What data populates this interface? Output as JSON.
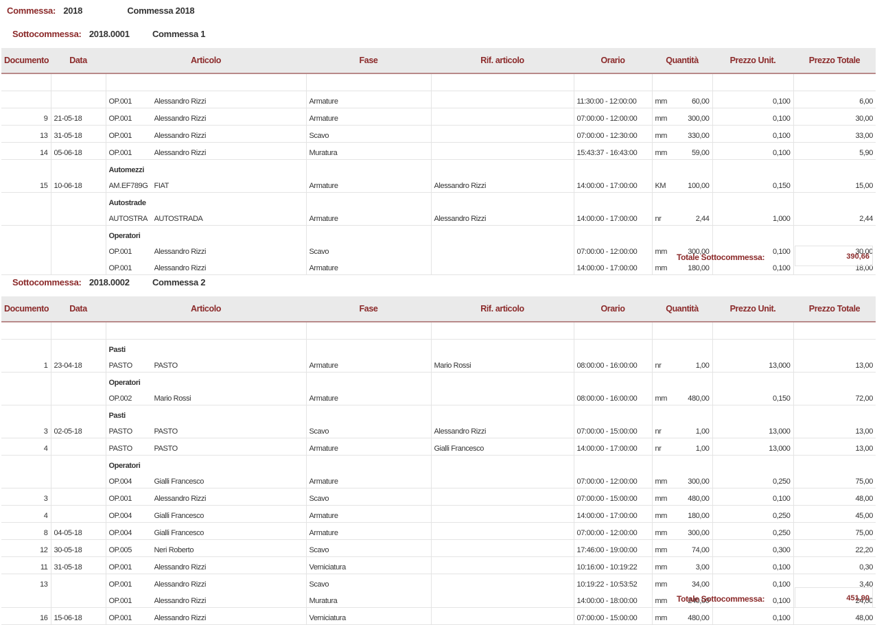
{
  "commessa": {
    "label": "Commessa:",
    "code": "2018",
    "desc": "Commessa 2018"
  },
  "columns": [
    "Documento",
    "Data",
    "Articolo",
    "Fase",
    "Rif. articolo",
    "Orario",
    "Quantità",
    "Prezzo Unit.",
    "Prezzo Totale"
  ],
  "sections": [
    {
      "label": "Sottocommessa:",
      "code": "2018.0001",
      "desc": "Commessa 1",
      "total_label": "Totale Sottocommessa:",
      "total": "390,66",
      "rows": [
        {
          "doc": "",
          "date": "",
          "group": "",
          "code": "OP.001",
          "name": "Alessandro Rizzi",
          "fase": "Armature",
          "rif": "",
          "orario": "11:30:00 - 12:00:00",
          "um": "mm",
          "qty": "60,00",
          "pu": "0,100",
          "pt": "6,00"
        },
        {
          "doc": "9",
          "date": "21-05-18",
          "group": "",
          "code": "OP.001",
          "name": "Alessandro Rizzi",
          "fase": "Armature",
          "rif": "",
          "orario": "07:00:00 - 12:00:00",
          "um": "mm",
          "qty": "300,00",
          "pu": "0,100",
          "pt": "30,00"
        },
        {
          "doc": "13",
          "date": "31-05-18",
          "group": "",
          "code": "OP.001",
          "name": "Alessandro Rizzi",
          "fase": "Scavo",
          "rif": "",
          "orario": "07:00:00 - 12:30:00",
          "um": "mm",
          "qty": "330,00",
          "pu": "0,100",
          "pt": "33,00"
        },
        {
          "doc": "14",
          "date": "05-06-18",
          "group": "",
          "code": "OP.001",
          "name": "Alessandro Rizzi",
          "fase": "Muratura",
          "rif": "",
          "orario": "15:43:37 - 16:43:00",
          "um": "mm",
          "qty": "59,00",
          "pu": "0,100",
          "pt": "5,90"
        },
        {
          "doc": "15",
          "date": "10-06-18",
          "group": "Automezzi",
          "code": "AM.EF789G",
          "name": "FIAT",
          "fase": "Armature",
          "rif": "Alessandro Rizzi",
          "orario": "14:00:00 - 17:00:00",
          "um": "KM",
          "qty": "100,00",
          "pu": "0,150",
          "pt": "15,00"
        },
        {
          "doc": "",
          "date": "",
          "group": "Autostrade",
          "code": "AUTOSTRA",
          "name": "AUTOSTRADA",
          "fase": "Armature",
          "rif": "Alessandro Rizzi",
          "orario": "14:00:00 - 17:00:00",
          "um": "nr",
          "qty": "2,44",
          "pu": "1,000",
          "pt": "2,44"
        },
        {
          "doc": "",
          "date": "",
          "group": "Operatori",
          "code": "OP.001",
          "name": "Alessandro Rizzi",
          "fase": "Scavo",
          "rif": "",
          "orario": "07:00:00 - 12:00:00",
          "um": "mm",
          "qty": "300,00",
          "pu": "0,100",
          "pt": "30,00"
        },
        {
          "doc": "",
          "date": "",
          "group": "",
          "code": "OP.001",
          "name": "Alessandro Rizzi",
          "fase": "Armature",
          "rif": "",
          "orario": "14:00:00 - 17:00:00",
          "um": "mm",
          "qty": "180,00",
          "pu": "0,100",
          "pt": "18,00",
          "cont": true
        }
      ]
    },
    {
      "label": "Sottocommessa:",
      "code": "2018.0002",
      "desc": "Commessa 2",
      "total_label": "Totale Sottocommessa:",
      "total": "451,90",
      "rows": [
        {
          "doc": "1",
          "date": "23-04-18",
          "group": "Pasti",
          "code": "PASTO",
          "name": "PASTO",
          "fase": "Armature",
          "rif": "Mario Rossi",
          "orario": "08:00:00 - 16:00:00",
          "um": "nr",
          "qty": "1,00",
          "pu": "13,000",
          "pt": "13,00"
        },
        {
          "doc": "",
          "date": "",
          "group": "Operatori",
          "code": "OP.002",
          "name": "Mario Rossi",
          "fase": "Armature",
          "rif": "",
          "orario": "08:00:00 - 16:00:00",
          "um": "mm",
          "qty": "480,00",
          "pu": "0,150",
          "pt": "72,00"
        },
        {
          "doc": "3",
          "date": "02-05-18",
          "group": "Pasti",
          "code": "PASTO",
          "name": "PASTO",
          "fase": "Scavo",
          "rif": "Alessandro Rizzi",
          "orario": "07:00:00 - 15:00:00",
          "um": "nr",
          "qty": "1,00",
          "pu": "13,000",
          "pt": "13,00"
        },
        {
          "doc": "4",
          "date": "",
          "group": "",
          "code": "PASTO",
          "name": "PASTO",
          "fase": "Armature",
          "rif": "Gialli Francesco",
          "orario": "14:00:00 - 17:00:00",
          "um": "nr",
          "qty": "1,00",
          "pu": "13,000",
          "pt": "13,00"
        },
        {
          "doc": "",
          "date": "",
          "group": "Operatori",
          "code": "OP.004",
          "name": "Gialli Francesco",
          "fase": "Armature",
          "rif": "",
          "orario": "07:00:00 - 12:00:00",
          "um": "mm",
          "qty": "300,00",
          "pu": "0,250",
          "pt": "75,00"
        },
        {
          "doc": "3",
          "date": "",
          "group": "",
          "code": "OP.001",
          "name": "Alessandro Rizzi",
          "fase": "Scavo",
          "rif": "",
          "orario": "07:00:00 - 15:00:00",
          "um": "mm",
          "qty": "480,00",
          "pu": "0,100",
          "pt": "48,00"
        },
        {
          "doc": "4",
          "date": "",
          "group": "",
          "code": "OP.004",
          "name": "Gialli Francesco",
          "fase": "Armature",
          "rif": "",
          "orario": "14:00:00 - 17:00:00",
          "um": "mm",
          "qty": "180,00",
          "pu": "0,250",
          "pt": "45,00"
        },
        {
          "doc": "8",
          "date": "04-05-18",
          "group": "",
          "code": "OP.004",
          "name": "Gialli Francesco",
          "fase": "Armature",
          "rif": "",
          "orario": "07:00:00 - 12:00:00",
          "um": "mm",
          "qty": "300,00",
          "pu": "0,250",
          "pt": "75,00"
        },
        {
          "doc": "12",
          "date": "30-05-18",
          "group": "",
          "code": "OP.005",
          "name": "Neri Roberto",
          "fase": "Scavo",
          "rif": "",
          "orario": "17:46:00 - 19:00:00",
          "um": "mm",
          "qty": "74,00",
          "pu": "0,300",
          "pt": "22,20"
        },
        {
          "doc": "11",
          "date": "31-05-18",
          "group": "",
          "code": "OP.001",
          "name": "Alessandro Rizzi",
          "fase": "Verniciatura",
          "rif": "",
          "orario": "10:16:00 - 10:19:22",
          "um": "mm",
          "qty": "3,00",
          "pu": "0,100",
          "pt": "0,30"
        },
        {
          "doc": "13",
          "date": "",
          "group": "",
          "code": "OP.001",
          "name": "Alessandro Rizzi",
          "fase": "Scavo",
          "rif": "",
          "orario": "10:19:22 - 10:53:52",
          "um": "mm",
          "qty": "34,00",
          "pu": "0,100",
          "pt": "3,40"
        },
        {
          "doc": "",
          "date": "",
          "group": "",
          "code": "OP.001",
          "name": "Alessandro Rizzi",
          "fase": "Muratura",
          "rif": "",
          "orario": "14:00:00 - 18:00:00",
          "um": "mm",
          "qty": "240,00",
          "pu": "0,100",
          "pt": "24,00",
          "cont": true
        },
        {
          "doc": "16",
          "date": "15-06-18",
          "group": "",
          "code": "OP.001",
          "name": "Alessandro Rizzi",
          "fase": "Verniciatura",
          "rif": "",
          "orario": "07:00:00 - 15:00:00",
          "um": "mm",
          "qty": "480,00",
          "pu": "0,100",
          "pt": "48,00"
        }
      ]
    }
  ]
}
